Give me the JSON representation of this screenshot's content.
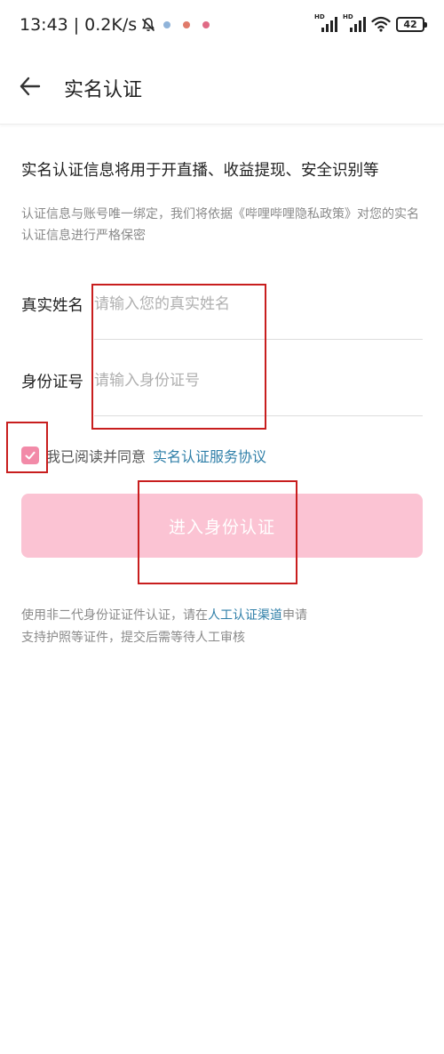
{
  "status_bar": {
    "time": "13:43",
    "separator": "|",
    "network_speed": "0.2K/s",
    "battery": "42",
    "signal_label": "HD",
    "icons": [
      "mute-icon",
      "notification-icon",
      "notification-icon",
      "notification-icon",
      "signal-icon",
      "signal-icon",
      "wifi-icon",
      "battery-icon"
    ]
  },
  "header": {
    "title": "实名认证"
  },
  "intro": {
    "headline": "实名认证信息将用于开直播、收益提现、安全识别等",
    "description": "认证信息与账号唯一绑定，我们将依据《哔哩哔哩隐私政策》对您的实名认证信息进行严格保密"
  },
  "form": {
    "name_label": "真实姓名",
    "name_placeholder": "请输入您的真实姓名",
    "id_label": "身份证号",
    "id_placeholder": "请输入身份证号"
  },
  "agreement": {
    "checked": true,
    "text": "我已阅读并同意",
    "link": "实名认证服务协议"
  },
  "submit": {
    "label": "进入身份认证"
  },
  "footer": {
    "line1_prefix": "使用非二代身份证证件认证，请在",
    "line1_link": "人工认证渠道",
    "line1_suffix": "申请",
    "line2": "支持护照等证件，提交后需等待人工审核"
  },
  "colors": {
    "accent_pink": "#f28aa8",
    "button_disabled_pink": "#fbc3d3",
    "link_blue": "#2f7fa8",
    "annotation_red": "#c81e1e"
  }
}
